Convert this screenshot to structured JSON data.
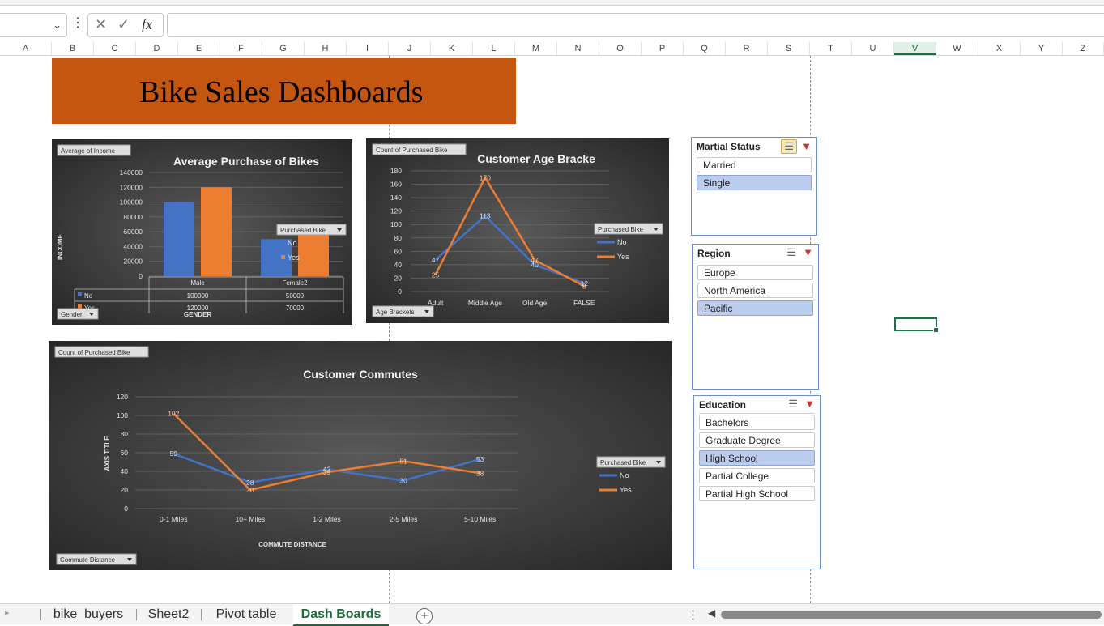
{
  "formula_bar": {
    "name_box": "",
    "cancel_icon": "✕",
    "enter_icon": "✓",
    "fx_label": "fx",
    "formula": ""
  },
  "columns": [
    "A",
    "B",
    "C",
    "D",
    "E",
    "F",
    "G",
    "H",
    "I",
    "J",
    "K",
    "L",
    "M",
    "N",
    "O",
    "P",
    "Q",
    "R",
    "S",
    "T",
    "U",
    "V",
    "W",
    "X",
    "Y",
    "Z"
  ],
  "selected_column": "V",
  "banner": {
    "title": "Bike Sales Dashboards"
  },
  "charts": {
    "income": {
      "field_button": "Average of Income",
      "axis_button": "Gender",
      "legend_button": "Purchased Bike",
      "title": "Average Purchase of Bikes",
      "ylabel": "INCOME",
      "xlabel": "GENDER"
    },
    "age": {
      "field_button": "Count of Purchased Bike",
      "axis_button": "Age Brackets",
      "legend_button": "Purchased Bike",
      "title": "Customer Age Bracke"
    },
    "commute": {
      "field_button": "Count of Purchased Bike",
      "axis_button": "Commute Distance",
      "legend_button": "Purchased Bike",
      "title": "Customer Commutes",
      "ylabel": "AXIS TITLE",
      "xlabel": "COMMUTE DISTANCE"
    }
  },
  "chart_data": [
    {
      "type": "bar",
      "title": "Average Purchase of Bikes",
      "xlabel": "GENDER",
      "ylabel": "INCOME",
      "categories": [
        "Male",
        "Female2"
      ],
      "series": [
        {
          "name": "No",
          "values": [
            100000,
            50000
          ],
          "color": "#4472c4"
        },
        {
          "name": "Yes",
          "values": [
            120000,
            70000
          ],
          "color": "#ed7d31"
        }
      ],
      "ylim": [
        0,
        140000
      ],
      "yticks": [
        0,
        20000,
        40000,
        60000,
        80000,
        100000,
        120000,
        140000
      ],
      "data_table": true,
      "grid": true,
      "legend": "right"
    },
    {
      "type": "line",
      "title": "Customer Age Bracke",
      "xlabel": "",
      "ylabel": "",
      "categories": [
        "Adult",
        "Middle Age",
        "Old Age",
        "FALSE"
      ],
      "series": [
        {
          "name": "No",
          "values": [
            47,
            113,
            40,
            12
          ],
          "color": "#4472c4"
        },
        {
          "name": "Yes",
          "values": [
            25,
            170,
            47,
            8
          ],
          "color": "#ed7d31"
        }
      ],
      "ylim": [
        0,
        180
      ],
      "yticks": [
        0,
        20,
        40,
        60,
        80,
        100,
        120,
        140,
        160,
        180
      ],
      "grid": true,
      "legend": "right"
    },
    {
      "type": "line",
      "title": "Customer Commutes",
      "xlabel": "COMMUTE DISTANCE",
      "ylabel": "AXIS TITLE",
      "categories": [
        "0-1 Miles",
        "10+ Miles",
        "1-2 Miles",
        "2-5 Miles",
        "5-10 Miles"
      ],
      "series": [
        {
          "name": "No",
          "values": [
            59,
            28,
            42,
            30,
            53
          ],
          "color": "#4472c4"
        },
        {
          "name": "Yes",
          "values": [
            102,
            20,
            39,
            51,
            38
          ],
          "color": "#ed7d31"
        }
      ],
      "ylim": [
        0,
        120
      ],
      "yticks": [
        0,
        20,
        40,
        60,
        80,
        100,
        120
      ],
      "grid": true,
      "legend": "right"
    }
  ],
  "slicers": [
    {
      "title": "Martial Status",
      "multiselect_on": true,
      "items": [
        {
          "label": "Married",
          "selected": false
        },
        {
          "label": "Single",
          "selected": true
        }
      ]
    },
    {
      "title": "Region",
      "multiselect_on": false,
      "items": [
        {
          "label": "Europe",
          "selected": false
        },
        {
          "label": "North America",
          "selected": false
        },
        {
          "label": "Pacific",
          "selected": true
        }
      ]
    },
    {
      "title": "Education",
      "multiselect_on": false,
      "items": [
        {
          "label": "Bachelors",
          "selected": false
        },
        {
          "label": "Graduate Degree",
          "selected": false
        },
        {
          "label": "High School",
          "selected": true
        },
        {
          "label": "Partial College",
          "selected": false
        },
        {
          "label": "Partial High School",
          "selected": false
        }
      ]
    }
  ],
  "sheet_tabs": [
    {
      "label": "bike_buyers",
      "active": false
    },
    {
      "label": "Sheet2",
      "active": false
    },
    {
      "label": "Pivot table",
      "active": false
    },
    {
      "label": "Dash Boards",
      "active": true
    }
  ],
  "add_sheet_label": "+"
}
